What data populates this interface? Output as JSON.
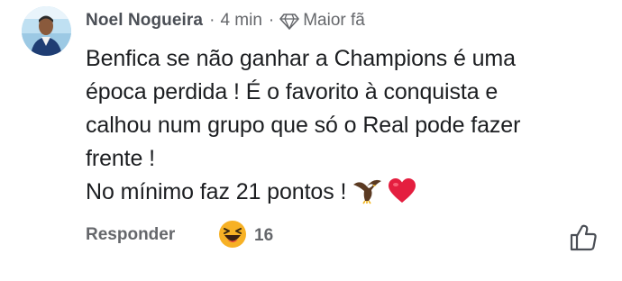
{
  "comment": {
    "author": "Noel Nogueira",
    "separator": "·",
    "time": "4 min",
    "badge_label": "Maior fã",
    "message_lines": [
      "Benfica se não ganhar a Champions é uma",
      "época perdida ! É o favorito à conquista e",
      "calhou num grupo que só o Real pode fazer",
      "frente !",
      "No mínimo faz 21 pontos !"
    ],
    "message_emojis": [
      "eagle-emoji",
      "red-heart-emoji"
    ]
  },
  "actions": {
    "reply_label": "Responder",
    "reaction_icon": "laughing-emoji",
    "reaction_count": "16",
    "like_icon": "thumbs-up-icon"
  },
  "colors": {
    "text_primary": "#1c1e21",
    "text_secondary": "#65676b",
    "heart": "#e41e3f",
    "emoji_yellow": "#f7b125"
  }
}
